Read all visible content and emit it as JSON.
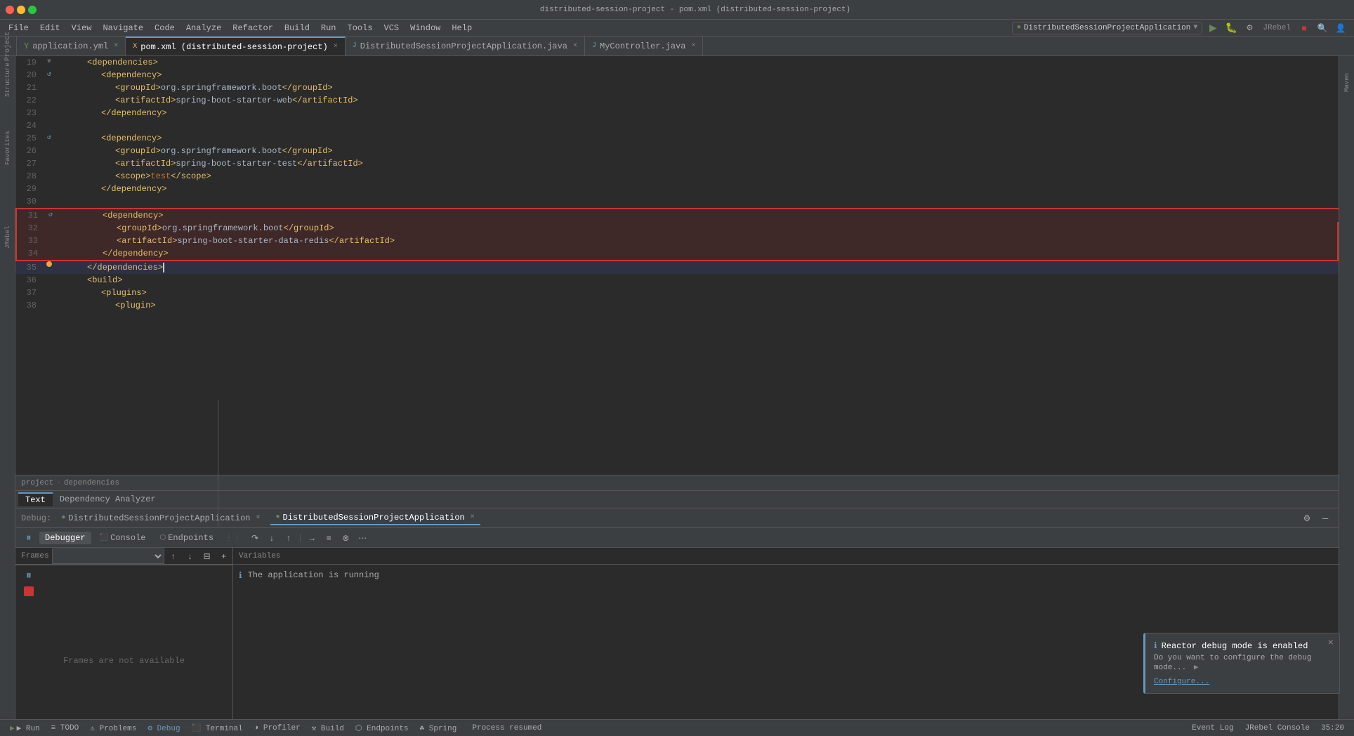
{
  "window": {
    "title": "distributed-session-project - pom.xml (distributed-session-project)",
    "project_name": "distributed-session-project",
    "active_file": "pom.xml"
  },
  "menu": {
    "items": [
      "File",
      "Edit",
      "View",
      "Navigate",
      "Code",
      "Analyze",
      "Refactor",
      "Build",
      "Run",
      "Tools",
      "VCS",
      "Window",
      "Help"
    ]
  },
  "tabs": [
    {
      "label": "application.yml",
      "type": "yaml",
      "active": false,
      "modified": false
    },
    {
      "label": "pom.xml (distributed-session-project)",
      "type": "xml",
      "active": true,
      "modified": false
    },
    {
      "label": "DistributedSessionProjectApplication.java",
      "type": "java",
      "active": false,
      "modified": false
    },
    {
      "label": "MyController.java",
      "type": "java",
      "active": false,
      "modified": false
    }
  ],
  "code": {
    "lines": [
      {
        "num": 19,
        "indent": 2,
        "content": "<dependencies>",
        "gutter": "fold"
      },
      {
        "num": 20,
        "indent": 3,
        "content": "<dependency>",
        "gutter": "reload"
      },
      {
        "num": 21,
        "indent": 4,
        "content": "<groupId>org.springframework.boot</groupId>"
      },
      {
        "num": 22,
        "indent": 4,
        "content": "<artifactId>spring-boot-starter-web</artifactId>"
      },
      {
        "num": 23,
        "indent": 3,
        "content": "</dependency>"
      },
      {
        "num": 24,
        "indent": 0,
        "content": ""
      },
      {
        "num": 25,
        "indent": 3,
        "content": "<dependency>",
        "gutter": "reload"
      },
      {
        "num": 26,
        "indent": 4,
        "content": "<groupId>org.springframework.boot</groupId>"
      },
      {
        "num": 27,
        "indent": 4,
        "content": "<artifactId>spring-boot-starter-test</artifactId>"
      },
      {
        "num": 28,
        "indent": 4,
        "content": "<scope>test</scope>"
      },
      {
        "num": 29,
        "indent": 3,
        "content": "</dependency>"
      },
      {
        "num": 30,
        "indent": 0,
        "content": ""
      },
      {
        "num": 31,
        "indent": 3,
        "content": "<dependency>",
        "highlight": true,
        "gutter": "reload"
      },
      {
        "num": 32,
        "indent": 4,
        "content": "<groupId>org.springframework.boot</groupId>",
        "highlight": true
      },
      {
        "num": 33,
        "indent": 4,
        "content": "<artifactId>spring-boot-starter-data-redis</artifactId>",
        "highlight": true
      },
      {
        "num": 34,
        "indent": 3,
        "content": "</dependency>",
        "highlight": true
      },
      {
        "num": 35,
        "indent": 2,
        "content": "</dependencies>",
        "cursor": true,
        "gutter": "dot"
      },
      {
        "num": 36,
        "indent": 2,
        "content": "<build>"
      },
      {
        "num": 37,
        "indent": 3,
        "content": "<plugins>"
      },
      {
        "num": 38,
        "indent": 4,
        "content": "<plugin>"
      }
    ]
  },
  "breadcrumb": {
    "items": [
      "project",
      "dependencies"
    ]
  },
  "bottom_tabs": [
    {
      "label": "Text",
      "active": true
    },
    {
      "label": "Dependency Analyzer",
      "active": false
    }
  ],
  "debug": {
    "label": "Debug:",
    "sessions": [
      {
        "label": "DistributedSessionProjectApplication",
        "active": false
      },
      {
        "label": "DistributedSessionProjectApplication",
        "active": true
      }
    ],
    "tabs": [
      {
        "label": "Debugger",
        "active": true
      },
      {
        "label": "Console",
        "active": false
      },
      {
        "label": "Endpoints",
        "active": false
      }
    ],
    "frames_label": "Frames",
    "frames_unavailable": "Frames are not available",
    "variables_label": "Variables",
    "running_message": "The application is running"
  },
  "status_bar": {
    "process": "Process resumed",
    "run_btn": "▶ Run",
    "todo_btn": "≡ TODO",
    "problems_btn": "⚠ Problems",
    "debug_btn": "⚙ Debug",
    "terminal_btn": "⬛ Terminal",
    "profiler_btn": "◑ Profiler",
    "build_btn": "⚒ Build",
    "endpoints_btn": "⬡ Endpoints",
    "spring_btn": "☘ Spring",
    "event_log": "Event Log",
    "jrebel_console": "JRebel Console",
    "position": "35:20"
  },
  "notification": {
    "title": "Reactor debug mode is enabled",
    "body": "Do you want to configure the debug mode...",
    "link": "Configure..."
  },
  "run_config": {
    "label": "DistributedSessionProjectApplication"
  }
}
